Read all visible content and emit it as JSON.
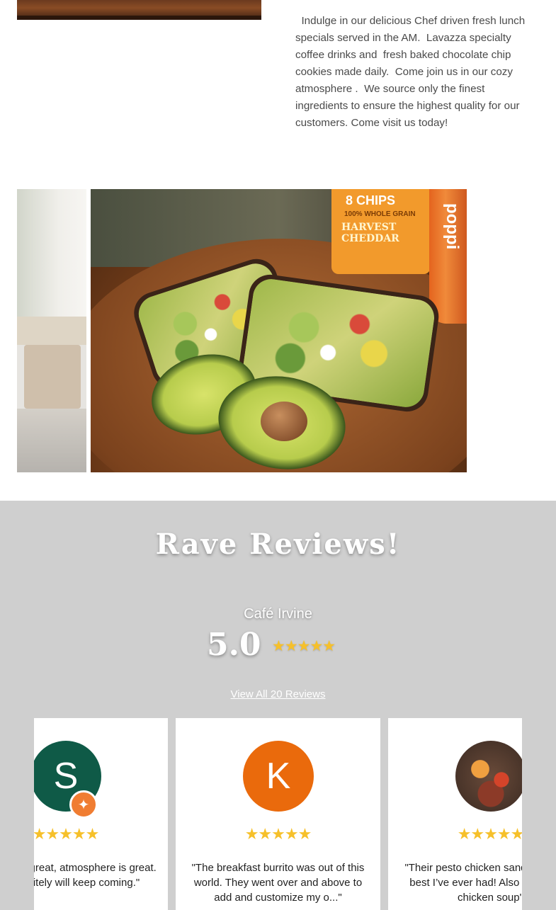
{
  "intro": {
    "text": "  Indulge in our delicious Chef driven fresh lunch specials served in the AM.  Lavazza specialty coffee drinks and  fresh baked chocolate chip cookies made daily.  Come join us in our cozy atmosphere .  We source only the finest ingredients to ensure the highest quality for our customers. Come visit us today!"
  },
  "gallery": {
    "chips_brand": "8 CHIPS",
    "chips_tagline": "100% WHOLE GRAIN",
    "chips_flavor": "HARVEST CHEDDAR",
    "can_brand": "poppi"
  },
  "reviews": {
    "title": "Rave Reviews!",
    "business": "Café Irvine",
    "score": "5.0",
    "stars": "★★★★★",
    "view_all": "View All 20 Reviews",
    "cards": [
      {
        "initial": "S",
        "stars": "★★★★★",
        "quote": "Food is great, atmosphere is great. Definitely will keep coming.\"",
        "avatar_color": "#0f5a47"
      },
      {
        "initial": "K",
        "stars": "★★★★★",
        "quote": "\"The breakfast burrito was out of this world. They went over and above to add and customize my o...\"",
        "avatar_color": "#ea6a0c"
      },
      {
        "initial": "",
        "stars": "★★★★★",
        "quote": "\"Their pesto chicken sandwich is the best I’ve ever had! Also loved their chicken soup\"",
        "avatar_color": "#5a3a2a"
      }
    ]
  },
  "colors": {
    "reviews_bg": "#cfcfcf",
    "star": "#f6c02a",
    "badge": "#f07d32"
  }
}
